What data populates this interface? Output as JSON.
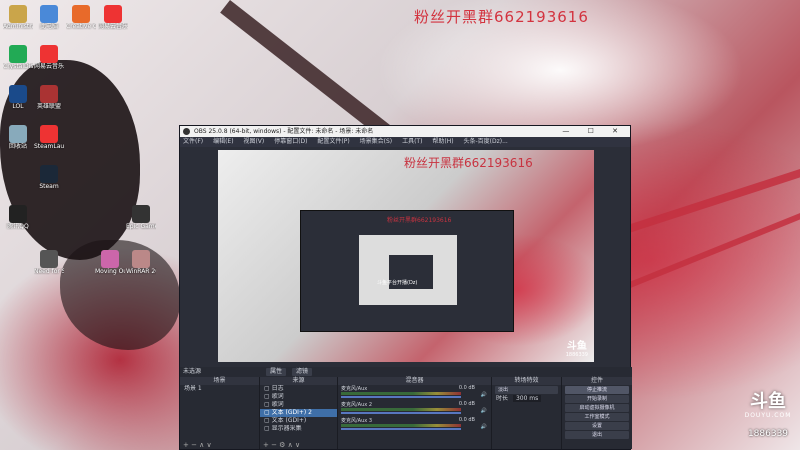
{
  "watermark": "粉丝开黑群662193616",
  "desktop_icons": [
    {
      "label": "Administrat..",
      "color": "#caa54a"
    },
    {
      "label": "此电脑",
      "color": "#4a89d8"
    },
    {
      "label": "Creative C..",
      "color": "#e86a2a"
    },
    {
      "label": "网易云音乐",
      "color": "#e33"
    },
    {
      "label": "CrystalDisk",
      "color": "#2a5"
    },
    {
      "label": "网易云音乐",
      "color": "#e33"
    },
    {
      "label": "LOL",
      "color": "#1a4a8a"
    },
    {
      "label": "英雄联盟",
      "color": "#a33"
    },
    {
      "label": "回收站",
      "color": "#8ab"
    },
    {
      "label": "SteamLaunc..",
      "color": "#e33"
    },
    {
      "label": "Steam",
      "color": "#1b2838"
    },
    {
      "label": "腾讯QQ",
      "color": "#222"
    },
    {
      "label": "Need for Speed",
      "color": "#555"
    },
    {
      "label": "Moving Out",
      "color": "#c6a"
    },
    {
      "label": "Epic Games Launcher",
      "color": "#333"
    },
    {
      "label": "WinRAR 2020",
      "color": "#b88"
    }
  ],
  "obs": {
    "title": "OBS 25.0.8 (64-bit, windows) - 配置文件: 未命名 - 场景: 未命名",
    "window_buttons": "— ☐ ✕",
    "menu": [
      "文件(F)",
      "编辑(E)",
      "视图(V)",
      "停靠窗口(D)",
      "配置文件(P)",
      "场景集合(S)",
      "工具(T)",
      "帮助(H)",
      "头条-百度(Dz)..."
    ],
    "preview_watermark": "粉丝开黑群662193616",
    "preview_small_watermark": "粉丝开黑群662193616",
    "nested_banner": "斗鱼平台开播(Dz)",
    "douyu_mini_logo": "斗鱼",
    "douyu_mini_id": "1886339",
    "scene_bar": {
      "label": "未选源",
      "btn_properties": "属性",
      "btn_filters": "滤镜"
    },
    "docks": {
      "scenes": {
        "header": "场景",
        "items": [
          "场景 1"
        ],
        "footer": "+ − ∧ ∨"
      },
      "sources": {
        "header": "来源",
        "items": [
          "日志",
          "歌词",
          "歌词",
          "文本 (GDI+) 2",
          "文本 (GDI+)",
          "显示器采集"
        ],
        "selected_index": 3,
        "footer": "+ − ⚙ ∧ ∨"
      },
      "mixer": {
        "header": "混音器",
        "rows": [
          {
            "label": "麦克风/Aux",
            "level": "0.0 dB"
          },
          {
            "label": "麦克风/Aux 2",
            "level": "0.0 dB"
          },
          {
            "label": "麦克风/Aux 3",
            "level": "0.0 dB"
          }
        ]
      },
      "transitions": {
        "header": "转场特效",
        "type": "淡出",
        "duration_label": "时长",
        "duration": "300 ms"
      },
      "controls": {
        "header": "控件",
        "buttons": [
          "停止推流",
          "开始录制",
          "启动虚拟摄像机",
          "工作室模式",
          "设置",
          "退出"
        ],
        "active_index": 0
      }
    }
  },
  "brand": {
    "logo": "斗鱼",
    "sub": "DOUYU.COM",
    "room_id": "1886339"
  }
}
